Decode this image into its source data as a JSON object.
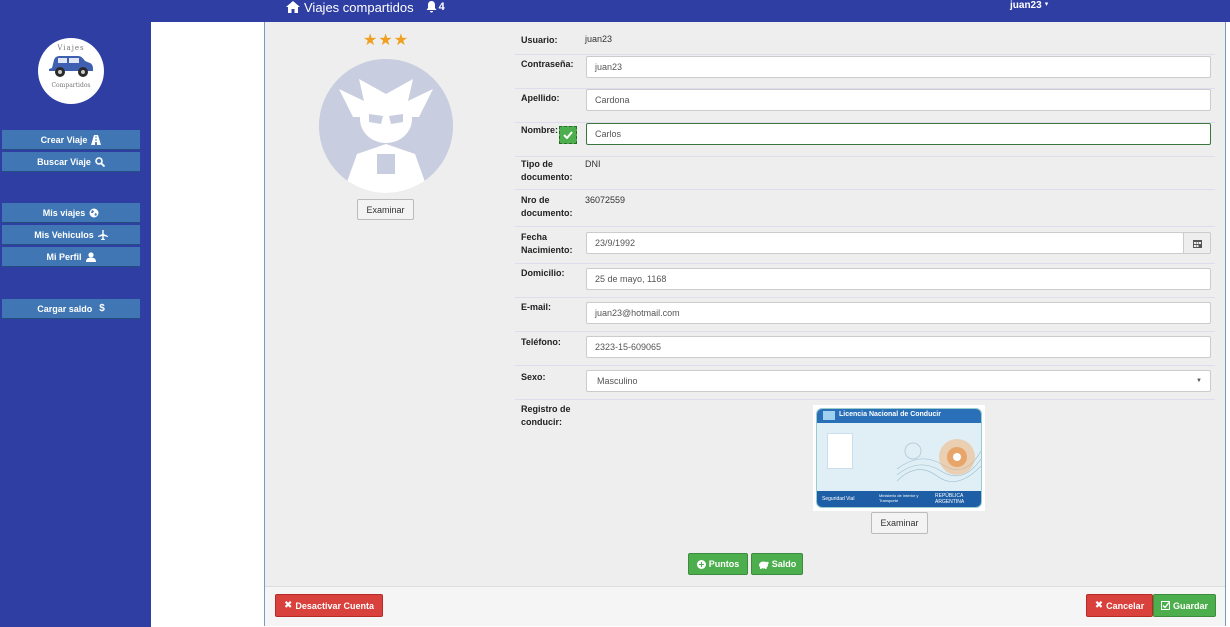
{
  "header": {
    "title": "Viajes compartidos",
    "notifications": "4",
    "user": "juan23",
    "user_caret": "▾"
  },
  "sidebar": {
    "logo_top": "Viajes",
    "logo_bottom": "Compartidos",
    "items": [
      {
        "label": "Crear Viaje",
        "icon": "road-icon"
      },
      {
        "label": "Buscar Viaje",
        "icon": "search-icon"
      },
      {
        "label": "Mis viajes",
        "icon": "globe-icon"
      },
      {
        "label": "Mis Vehiculos",
        "icon": "plane-icon"
      },
      {
        "label": "Mi Perfil",
        "icon": "user-icon"
      },
      {
        "label": "Cargar saldo",
        "icon": "dollar-icon"
      }
    ]
  },
  "profile": {
    "stars": "★★★",
    "rating_count": 3,
    "avatar_button": "Examinar"
  },
  "form": {
    "usuario_label": "Usuario:",
    "usuario_value": "juan23",
    "password_label": "Contraseña:",
    "password_value": "juan23",
    "apellido_label": "Apellido:",
    "apellido_value": "Cardona",
    "nombre_label": "Nombre:",
    "nombre_value": "Carlos",
    "tipo_doc_label_1": "Tipo de",
    "tipo_doc_label_2": "documento:",
    "tipo_doc_value": "DNI",
    "nro_doc_label_1": "Nro de",
    "nro_doc_label_2": "documento:",
    "nro_doc_value": "36072559",
    "fecha_label_1": "Fecha",
    "fecha_label_2": "Nacimiento:",
    "fecha_value": "23/9/1992",
    "domicilio_label": "Domicilio:",
    "domicilio_value": "25 de mayo, 1168",
    "email_label": "E-mail:",
    "email_value": "juan23@hotmail.com",
    "telefono_label": "Teléfono:",
    "telefono_value": "2323-15-609065",
    "sexo_label": "Sexo:",
    "sexo_value": "Masculino",
    "registro_label_1": "Registro de",
    "registro_label_2": "conducir:",
    "license_title": "Licencia Nacional de Conducir",
    "license_org_1": "Seguridad Vial",
    "license_org_2": "Ministerio de Interior y Transporte",
    "license_country_1": "REPÚBLICA",
    "license_country_2": "ARGENTINA",
    "license_button": "Examinar"
  },
  "actions": {
    "puntos": "Puntos",
    "saldo": "Saldo",
    "desactivar": "Desactivar Cuenta",
    "cancelar": "Cancelar",
    "guardar": "Guardar"
  },
  "colors": {
    "nav": "#2f3ea3",
    "button_blue": "#3f76b3",
    "success": "#4cae4c",
    "danger": "#d9413d",
    "star": "#f0a020"
  }
}
